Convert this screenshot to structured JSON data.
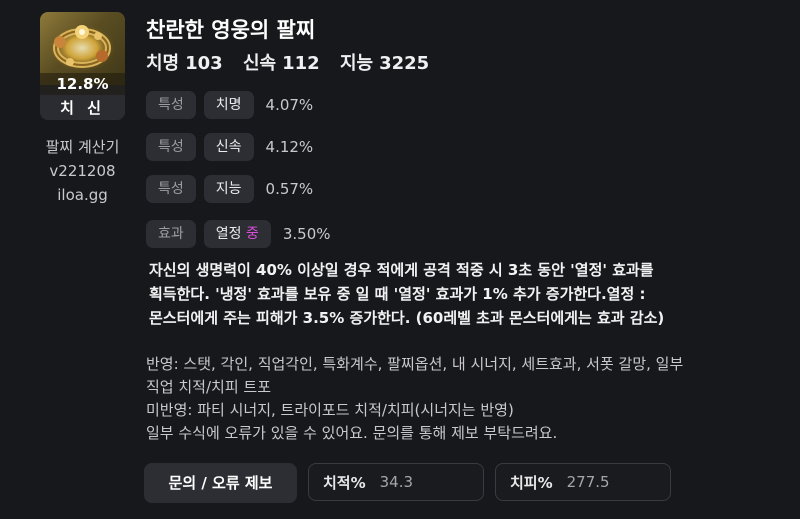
{
  "item": {
    "title": "찬란한 영웅의 팔찌",
    "percent": "12.8%",
    "tag": "치 신",
    "icon": "bracelet-icon",
    "stats": [
      {
        "label": "치명",
        "value": "103"
      },
      {
        "label": "신속",
        "value": "112"
      },
      {
        "label": "지능",
        "value": "3225"
      }
    ]
  },
  "calculator": {
    "name": "팔찌 계산기",
    "version": "v221208",
    "site": "iloa.gg"
  },
  "options": [
    {
      "type": "특성",
      "name": "치명",
      "grade": "",
      "value": "4.07%"
    },
    {
      "type": "특성",
      "name": "신속",
      "grade": "",
      "value": "4.12%"
    },
    {
      "type": "특성",
      "name": "지능",
      "grade": "",
      "value": "0.57%"
    },
    {
      "type": "효과",
      "name": "열정",
      "grade": "중",
      "value": "3.50%"
    }
  ],
  "description": [
    "자신의 생명력이 40% 이상일 경우 적에게 공격 적중 시 3초 동안 '열정' 효과를",
    "획득한다. '냉정' 효과를 보유 중 일 때 '열정' 효과가 1% 추가 증가한다.열정 :",
    "몬스터에게 주는 피해가 3.5% 증가한다. (60레벨 초과 몬스터에게는 효과 감소)"
  ],
  "notes": [
    "반영: 스탯, 각인, 직업각인, 특화계수, 팔찌옵션, 내 시너지, 세트효과, 서폿 갈망, 일부",
    "직업 치적/치피 트포",
    "미반영: 파티 시너지, 트라이포드 치적/치피(시너지는 반영)",
    "일부 수식에 오류가 있을 수 있어요. 문의를 통해 제보 부탁드려요."
  ],
  "controls": {
    "report_label": "문의 / 오류 제보",
    "crit_rate_label": "치적%",
    "crit_rate_value": "34.3",
    "crit_dmg_label": "치피%",
    "crit_dmg_value": "277.5"
  },
  "colors": {
    "background": "#17181b",
    "pill": "#2d2e33",
    "grade_accent": "#d94dd9"
  }
}
